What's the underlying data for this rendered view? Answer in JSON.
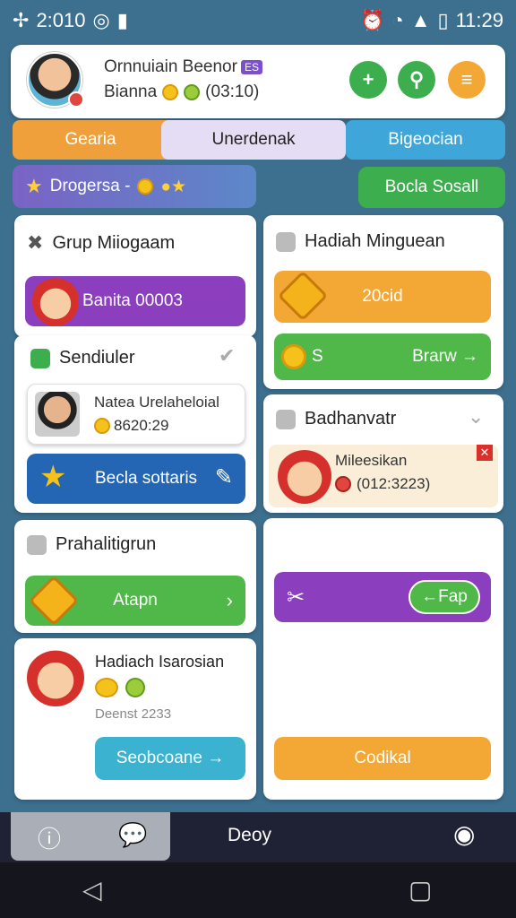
{
  "status_bar": {
    "time_left": "2:010",
    "time_right": "11:29"
  },
  "profile": {
    "name": "Ornnuiain Beenor",
    "name_tag": "ES",
    "sub_label": "Bianna",
    "stat_value": "(03:10)"
  },
  "tabs": [
    "Gearia",
    "Unerdenak",
    "Bigeocian"
  ],
  "progress_pill": "Drogersa -",
  "social_button": "Bocla Sosall",
  "panels": {
    "grup": {
      "title": "Grup Miiogaam",
      "button": "Banita 00003"
    },
    "hadiah_mingguan": {
      "title": "Hadiah Minguean",
      "button_1": "20cid",
      "button_2_left": "S",
      "button_2_right": "Brarw →"
    },
    "sendiuler": {
      "title": "Sendiuler",
      "card_name": "Natea Urelaheloial",
      "card_value": "8620:29",
      "button": "Becla sottaris"
    },
    "badhanvatr": {
      "title": "Badhanvatr",
      "card_name": "Mileesikan",
      "card_value": "(012:3223)"
    },
    "prahal": {
      "title": "Prahalitigrun",
      "button": "Atapn"
    },
    "right_bottom": {
      "pill": "←Fap",
      "button": "Codikal"
    },
    "hadiah_sarosian": {
      "title": "Hadiach Isarosian",
      "stat": "Deenst 2233",
      "button": "Seobcoane →"
    }
  },
  "bottom_nav": {
    "center_label": "Deoy"
  },
  "colors": {
    "green": "#3cae4e",
    "orange": "#f3a734",
    "purple": "#7c3fbf",
    "blue": "#2466b3",
    "teal": "#3bb2cf"
  }
}
